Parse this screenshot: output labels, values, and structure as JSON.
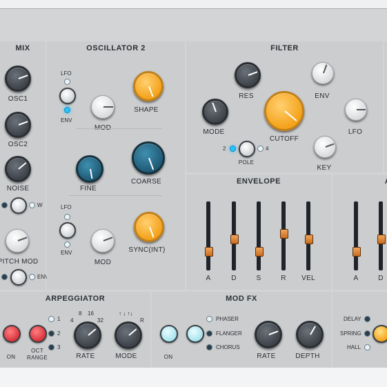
{
  "mix": {
    "title": "MIX",
    "knobs": [
      "OSC1",
      "OSC2",
      "NOISE"
    ],
    "wave_label": "W",
    "pitch_mod_label": "PITCH MOD",
    "env_label": "ENV"
  },
  "osc2": {
    "title": "OSCILLATOR 2",
    "lfo": "LFO",
    "env": "ENV",
    "mod": "MOD",
    "shape": "SHAPE",
    "fine": "FINE",
    "coarse": "COARSE",
    "lfo2": "LFO",
    "env2": "ENV",
    "mod2": "MOD",
    "sync": "SYNC(INT)"
  },
  "filter": {
    "title": "FILTER",
    "res": "RES",
    "env": "ENV",
    "mode": "MODE",
    "cutoff": "CUTOFF",
    "lfo": "LFO",
    "pole": "POLE",
    "pole_left": "2",
    "pole_right": "4",
    "key": "KEY"
  },
  "envelope": {
    "title": "ENVELOPE",
    "faders": [
      {
        "label": "A",
        "level": 0.25
      },
      {
        "label": "D",
        "level": 0.45
      },
      {
        "label": "S",
        "level": 0.25
      },
      {
        "label": "R",
        "level": 0.55
      },
      {
        "label": "VEL",
        "level": 0.45
      }
    ]
  },
  "amp": {
    "title": "A",
    "faders": [
      {
        "label": "A",
        "level": 0.25
      },
      {
        "label": "D",
        "level": 0.45
      }
    ]
  },
  "arp": {
    "title": "ARPEGGIATOR",
    "on": "ON",
    "oct_range": "OCT\nRANGE",
    "range_values": [
      "1",
      "2",
      "3"
    ],
    "rate": "RATE",
    "rate_ticks": [
      "4",
      "8",
      "16",
      "32"
    ],
    "mode": "MODE",
    "mode_r": "R"
  },
  "modfx": {
    "title": "MOD FX",
    "on": "ON",
    "options": [
      "PHASER",
      "FLANGER",
      "CHORUS"
    ],
    "rate": "RATE",
    "depth": "DEPTH"
  },
  "reverb": {
    "options": [
      "DELAY",
      "SPRING",
      "HALL"
    ]
  },
  "colors": {
    "orange": "#f4a21a",
    "blue": "#1f5a75",
    "red": "#e0434a",
    "cyan_led": "#27c3ff"
  }
}
